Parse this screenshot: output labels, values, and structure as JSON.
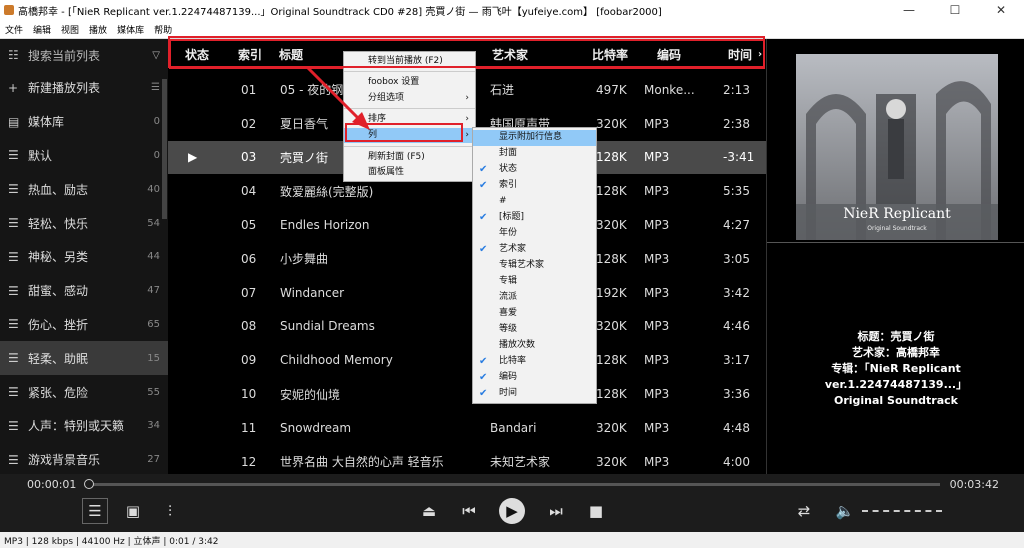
{
  "window": {
    "title": "高橋邦幸 - [「NieR Replicant ver.1.22474487139...」Original Soundtrack CD0 #28] 壳買ノ街 — 雨飞叶【yufeiye.com】 [foobar2000]",
    "btn_min": "—",
    "btn_max": "☐",
    "btn_close": "✕"
  },
  "menu": [
    "文件",
    "编辑",
    "视图",
    "播放",
    "媒体库",
    "帮助"
  ],
  "sidebar": {
    "search_placeholder": "搜索当前列表",
    "items": [
      {
        "label": "新建播放列表",
        "count": "",
        "icon": "plus-icon"
      },
      {
        "label": "媒体库",
        "count": "0",
        "icon": "library-icon"
      },
      {
        "label": "默认",
        "count": "0",
        "icon": "list-icon"
      },
      {
        "label": "热血、励志",
        "count": "40",
        "icon": "list-icon"
      },
      {
        "label": "轻松、快乐",
        "count": "54",
        "icon": "list-icon"
      },
      {
        "label": "神秘、另类",
        "count": "44",
        "icon": "list-icon"
      },
      {
        "label": "甜蜜、感动",
        "count": "47",
        "icon": "list-icon"
      },
      {
        "label": "伤心、挫折",
        "count": "65",
        "icon": "list-icon"
      },
      {
        "label": "轻柔、助眠",
        "count": "15",
        "icon": "list-icon"
      },
      {
        "label": "紧张、危险",
        "count": "55",
        "icon": "list-icon"
      },
      {
        "label": "人声：特别或天籁",
        "count": "34",
        "icon": "list-icon"
      },
      {
        "label": "游戏背景音乐",
        "count": "27",
        "icon": "list-icon"
      }
    ]
  },
  "columns": {
    "status": "状态",
    "index": "索引",
    "title": "标题",
    "artist": "艺术家",
    "bitrate": "比特率",
    "codec": "编码",
    "time": "时间"
  },
  "tracks": [
    {
      "index": "01",
      "title": "05 - 夜的钢琴曲",
      "artist": "石进",
      "bitrate": "497K",
      "codec": "Monke...",
      "time": "2:13"
    },
    {
      "index": "02",
      "title": "夏日香气",
      "artist": "韩国原声带",
      "bitrate": "320K",
      "codec": "MP3",
      "time": "2:38"
    },
    {
      "index": "03",
      "title": "壳買ノ街",
      "artist": "",
      "bitrate": "128K",
      "codec": "MP3",
      "time": "-3:41",
      "status": "▶"
    },
    {
      "index": "04",
      "title": "致爱麗絲(完整版)",
      "artist": "",
      "bitrate": "128K",
      "codec": "MP3",
      "time": "5:35"
    },
    {
      "index": "05",
      "title": "Endles Horizon",
      "artist": "",
      "bitrate": "320K",
      "codec": "MP3",
      "time": "4:27"
    },
    {
      "index": "06",
      "title": "小步舞曲",
      "artist": "",
      "bitrate": "128K",
      "codec": "MP3",
      "time": "3:05"
    },
    {
      "index": "07",
      "title": "Windancer",
      "artist": "",
      "bitrate": "192K",
      "codec": "MP3",
      "time": "3:42"
    },
    {
      "index": "08",
      "title": "Sundial Dreams",
      "artist": "",
      "bitrate": "320K",
      "codec": "MP3",
      "time": "4:46"
    },
    {
      "index": "09",
      "title": "Childhood Memory",
      "artist": "",
      "bitrate": "128K",
      "codec": "MP3",
      "time": "3:17"
    },
    {
      "index": "10",
      "title": "安妮的仙境",
      "artist": "",
      "bitrate": "128K",
      "codec": "MP3",
      "time": "3:36"
    },
    {
      "index": "11",
      "title": "Snowdream",
      "artist": "Bandari",
      "bitrate": "320K",
      "codec": "MP3",
      "time": "4:48"
    },
    {
      "index": "12",
      "title": "世界名曲 大自然的心声 轻音乐",
      "artist": "未知艺术家",
      "bitrate": "320K",
      "codec": "MP3",
      "time": "4:00"
    }
  ],
  "context_menu": {
    "goto": "转到当前播放 (F2)",
    "foobox": "foobox 设置",
    "group": "分组选项",
    "sort": "排序",
    "columns": "列",
    "refresh": "刷新封面 (F5)",
    "props": "面板属性"
  },
  "submenu": [
    {
      "label": "显示附加行信息",
      "checked": false
    },
    {
      "label": "封面",
      "checked": false
    },
    {
      "label": "状态",
      "checked": true
    },
    {
      "label": "索引",
      "checked": true
    },
    {
      "label": "#",
      "checked": false
    },
    {
      "label": "[标题]",
      "checked": true
    },
    {
      "label": "年份",
      "checked": false
    },
    {
      "label": "艺术家",
      "checked": true
    },
    {
      "label": "专辑艺术家",
      "checked": false
    },
    {
      "label": "专辑",
      "checked": false
    },
    {
      "label": "流派",
      "checked": false
    },
    {
      "label": "喜爱",
      "checked": false
    },
    {
      "label": "等级",
      "checked": false
    },
    {
      "label": "播放次数",
      "checked": false
    },
    {
      "label": "比特率",
      "checked": true
    },
    {
      "label": "编码",
      "checked": true
    },
    {
      "label": "时间",
      "checked": true
    }
  ],
  "album_art": {
    "cover_title": "NieR Replicant",
    "cover_sub": "Original Soundtrack",
    "meta_title": "标题：壳買ノ街",
    "meta_artist": "艺术家：高橋邦幸",
    "meta_album": "专辑：「NieR Replicant ver.1.22474487139...」",
    "meta_album2": "Original Soundtrack"
  },
  "player": {
    "elapsed": "00:00:01",
    "total": "00:03:42",
    "progress": 0.004
  },
  "statusbar": "MP3 | 128 kbps | 44100 Hz | 立体声 | 0:01 / 3:42",
  "colors": {
    "accent": "#e0202a",
    "highlight": "#91c9f7"
  }
}
